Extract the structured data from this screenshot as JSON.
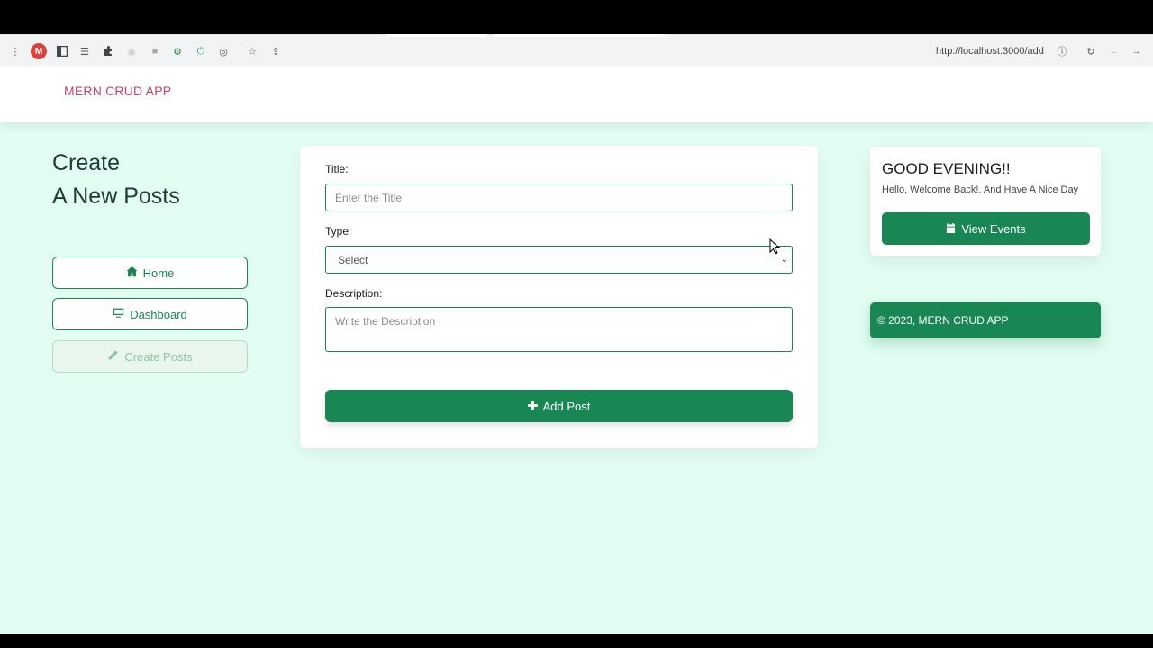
{
  "browser": {
    "url": "http://localhost:3000/add",
    "profile_letter": "M",
    "icons": [
      "menu-dots-icon",
      "profile-icon",
      "sidebar-icon",
      "list-icon",
      "puzzle-icon",
      "extension-icon",
      "extension-icon",
      "extension-icon",
      "power-icon",
      "circle-icon",
      "star-icon",
      "share-icon",
      "info-icon",
      "reload-icon",
      "back-icon",
      "forward-icon"
    ]
  },
  "navbar": {
    "brand": "MERN CRUD APP"
  },
  "sidebar": {
    "heading_line1": "Create",
    "heading_line2": "A New Posts",
    "items": [
      {
        "label": "Home",
        "icon": "home-icon",
        "state": "enabled"
      },
      {
        "label": "Dashboard",
        "icon": "monitor-icon",
        "state": "enabled"
      },
      {
        "label": "Create Posts",
        "icon": "pencil-icon",
        "state": "disabled"
      }
    ]
  },
  "form": {
    "title_label": "Title:",
    "title_placeholder": "Enter the Title",
    "type_label": "Type:",
    "type_selected": "Select",
    "description_label": "Description:",
    "description_placeholder": "Write the Description",
    "submit_label": "Add Post",
    "submit_icon": "plus-icon"
  },
  "greeting": {
    "title": "GOOD EVENING!!",
    "subtitle": "Hello, Welcome Back!. And Have A Nice Day",
    "button_label": "View Events",
    "button_icon": "calendar-icon"
  },
  "footer": {
    "text": "© 2023, MERN CRUD APP"
  },
  "colors": {
    "accent": "#198754",
    "brand": "#c2436a",
    "page_bg": "#e2fdf1"
  }
}
